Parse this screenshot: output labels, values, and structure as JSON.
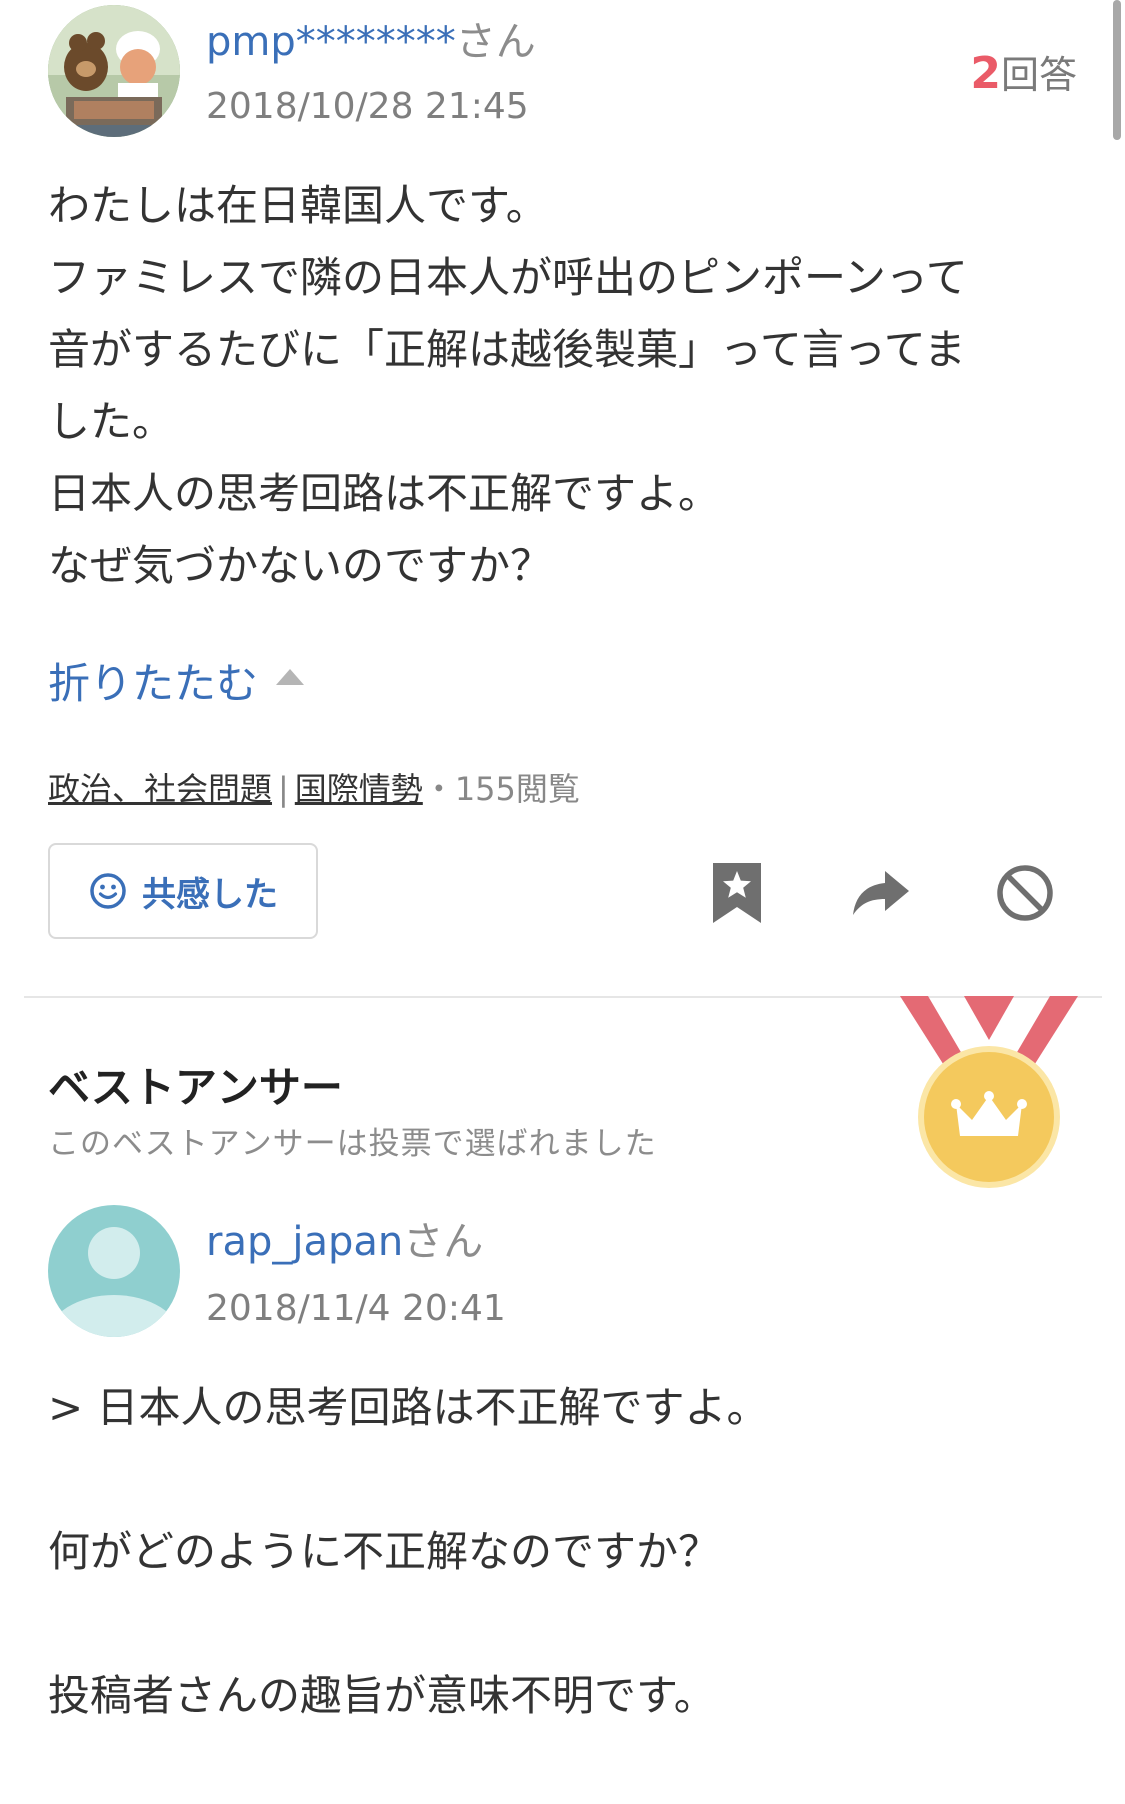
{
  "question": {
    "user_name": "pmp********",
    "user_suffix": "さん",
    "date": "2018/10/28 21:45",
    "answer_count": "2",
    "answer_unit": "回答",
    "body_lines": [
      "わたしは在日韓国人です。",
      "ファミレスで隣の日本人が呼出のピンポーンって",
      "音がするたびに「正解は越後製菓」って言ってま",
      "した。",
      "日本人の思考回路は不正解ですよ。",
      "なぜ気づかないのですか？"
    ],
    "collapse_label": "折りたたむ",
    "category_primary": "政治、社会問題",
    "category_separator": "|",
    "category_secondary": "国際情勢",
    "views": "・155閲覧"
  },
  "actions": {
    "sympathy_label": "共感した",
    "icons": [
      "smile-icon",
      "bookmark-star-icon",
      "share-arrow-icon",
      "block-icon"
    ]
  },
  "best_answer": {
    "title": "ベストアンサー",
    "subtitle": "このベストアンサーは投票で選ばれました",
    "user_name": "rap_japan",
    "user_suffix": "さん",
    "date": "2018/11/4 20:41",
    "paragraphs": [
      "> 日本人の思考回路は不正解ですよ。",
      "何がどのように不正解なのですか？",
      "投稿者さんの趣旨が意味不明です。"
    ]
  },
  "colors": {
    "link_blue": "#3a6fb8",
    "answer_count_red": "#ea5b68",
    "medal_gold": "#f4c95d",
    "ribbon_red": "#e46a74",
    "avatar_teal": "#8fcfcf"
  }
}
